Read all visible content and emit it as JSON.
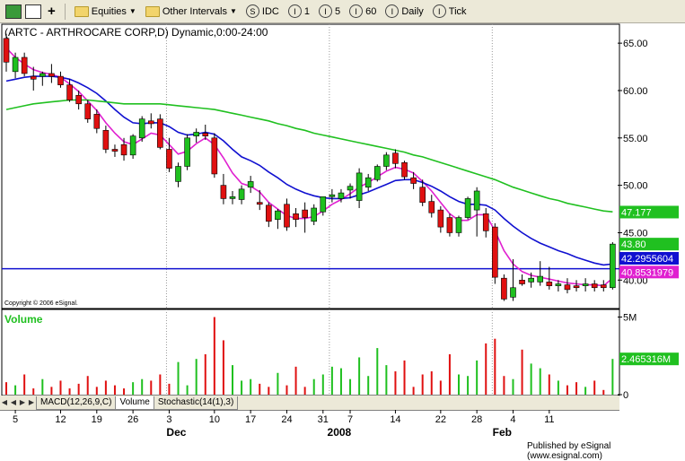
{
  "toolbar": {
    "equities_label": "Equities",
    "intervals_label": "Other Intervals",
    "symbol_label": "IDC",
    "interval_1": "1",
    "interval_5": "5",
    "interval_60": "60",
    "daily_label": "Daily",
    "tick_label": "Tick"
  },
  "chart_data": [
    {
      "type": "candlestick",
      "title": "(ARTC - ARTHROCARE CORP,D) Dynamic,0:00-24:00",
      "copyright": "Copyright © 2006 eSignal.",
      "ylim": [
        37,
        67
      ],
      "y_ticks": [
        "65.00",
        "60.00",
        "55.00",
        "50.00",
        "45.00",
        "40.00"
      ],
      "horizontal_line": 41.2,
      "candles": [
        {
          "o": 65.5,
          "h": 66.0,
          "l": 62.0,
          "c": 63.0
        },
        {
          "o": 62.0,
          "h": 64.0,
          "l": 61.3,
          "c": 63.5
        },
        {
          "o": 63.5,
          "h": 64.0,
          "l": 61.5,
          "c": 61.8
        },
        {
          "o": 61.5,
          "h": 62.5,
          "l": 60.0,
          "c": 61.2
        },
        {
          "o": 61.5,
          "h": 62.0,
          "l": 60.5,
          "c": 61.8
        },
        {
          "o": 61.8,
          "h": 62.8,
          "l": 60.8,
          "c": 61.5
        },
        {
          "o": 61.5,
          "h": 62.0,
          "l": 60.3,
          "c": 60.6
        },
        {
          "o": 60.6,
          "h": 61.2,
          "l": 58.8,
          "c": 59.0
        },
        {
          "o": 59.5,
          "h": 60.0,
          "l": 58.0,
          "c": 58.6
        },
        {
          "o": 58.6,
          "h": 59.0,
          "l": 56.6,
          "c": 57.0
        },
        {
          "o": 57.5,
          "h": 58.0,
          "l": 55.5,
          "c": 56.0
        },
        {
          "o": 55.8,
          "h": 56.3,
          "l": 53.4,
          "c": 53.8
        },
        {
          "o": 53.8,
          "h": 54.3,
          "l": 53.0,
          "c": 53.6
        },
        {
          "o": 54.3,
          "h": 55.0,
          "l": 52.6,
          "c": 53.2
        },
        {
          "o": 53.2,
          "h": 55.4,
          "l": 52.8,
          "c": 55.2
        },
        {
          "o": 55.0,
          "h": 57.3,
          "l": 54.6,
          "c": 57.0
        },
        {
          "o": 56.8,
          "h": 57.6,
          "l": 56.0,
          "c": 56.5
        },
        {
          "o": 57.0,
          "h": 57.5,
          "l": 53.8,
          "c": 54.0
        },
        {
          "o": 53.8,
          "h": 55.0,
          "l": 51.4,
          "c": 51.8
        },
        {
          "o": 50.4,
          "h": 52.4,
          "l": 49.8,
          "c": 52.0
        },
        {
          "o": 52.0,
          "h": 55.4,
          "l": 51.6,
          "c": 55.0
        },
        {
          "o": 55.2,
          "h": 56.0,
          "l": 54.5,
          "c": 55.6
        },
        {
          "o": 55.5,
          "h": 56.4,
          "l": 54.8,
          "c": 55.2
        },
        {
          "o": 55.0,
          "h": 55.5,
          "l": 50.8,
          "c": 51.2
        },
        {
          "o": 50.0,
          "h": 51.2,
          "l": 48.0,
          "c": 48.6
        },
        {
          "o": 48.6,
          "h": 49.4,
          "l": 48.0,
          "c": 48.8
        },
        {
          "o": 48.5,
          "h": 50.0,
          "l": 48.0,
          "c": 49.6
        },
        {
          "o": 49.8,
          "h": 51.0,
          "l": 49.2,
          "c": 50.4
        },
        {
          "o": 48.2,
          "h": 49.5,
          "l": 47.4,
          "c": 48.0
        },
        {
          "o": 47.9,
          "h": 48.2,
          "l": 45.6,
          "c": 46.2
        },
        {
          "o": 46.4,
          "h": 47.5,
          "l": 45.4,
          "c": 47.3
        },
        {
          "o": 48.0,
          "h": 48.6,
          "l": 45.2,
          "c": 45.6
        },
        {
          "o": 47.0,
          "h": 47.6,
          "l": 45.6,
          "c": 46.4
        },
        {
          "o": 47.4,
          "h": 48.2,
          "l": 45.0,
          "c": 46.6
        },
        {
          "o": 46.2,
          "h": 48.0,
          "l": 45.8,
          "c": 47.6
        },
        {
          "o": 47.2,
          "h": 48.8,
          "l": 46.8,
          "c": 48.8
        },
        {
          "o": 48.8,
          "h": 49.6,
          "l": 48.2,
          "c": 49.0
        },
        {
          "o": 48.6,
          "h": 49.6,
          "l": 48.2,
          "c": 49.2
        },
        {
          "o": 49.5,
          "h": 50.2,
          "l": 48.6,
          "c": 49.9
        },
        {
          "o": 48.4,
          "h": 51.8,
          "l": 47.6,
          "c": 51.3
        },
        {
          "o": 49.8,
          "h": 51.2,
          "l": 49.4,
          "c": 50.8
        },
        {
          "o": 50.6,
          "h": 52.2,
          "l": 50.4,
          "c": 52.0
        },
        {
          "o": 52.0,
          "h": 53.5,
          "l": 51.6,
          "c": 53.2
        },
        {
          "o": 53.4,
          "h": 53.8,
          "l": 51.8,
          "c": 52.3
        },
        {
          "o": 52.4,
          "h": 52.6,
          "l": 50.6,
          "c": 50.9
        },
        {
          "o": 50.8,
          "h": 51.4,
          "l": 49.6,
          "c": 50.2
        },
        {
          "o": 49.8,
          "h": 50.6,
          "l": 47.8,
          "c": 48.2
        },
        {
          "o": 48.3,
          "h": 49.0,
          "l": 46.6,
          "c": 47.1
        },
        {
          "o": 47.4,
          "h": 47.8,
          "l": 45.0,
          "c": 45.6
        },
        {
          "o": 46.6,
          "h": 47.0,
          "l": 44.6,
          "c": 45.0
        },
        {
          "o": 45.0,
          "h": 46.8,
          "l": 44.6,
          "c": 46.6
        },
        {
          "o": 46.6,
          "h": 48.8,
          "l": 46.4,
          "c": 48.6
        },
        {
          "o": 47.4,
          "h": 49.8,
          "l": 44.6,
          "c": 49.4
        },
        {
          "o": 47.0,
          "h": 47.6,
          "l": 44.5,
          "c": 45.2
        },
        {
          "o": 45.6,
          "h": 46.0,
          "l": 39.6,
          "c": 40.3
        },
        {
          "o": 40.2,
          "h": 40.6,
          "l": 37.8,
          "c": 38.0
        },
        {
          "o": 38.2,
          "h": 42.2,
          "l": 37.8,
          "c": 39.2
        },
        {
          "o": 40.0,
          "h": 40.6,
          "l": 39.4,
          "c": 39.6
        },
        {
          "o": 39.8,
          "h": 40.8,
          "l": 39.2,
          "c": 40.2
        },
        {
          "o": 39.8,
          "h": 42.0,
          "l": 39.4,
          "c": 40.4
        },
        {
          "o": 39.8,
          "h": 41.4,
          "l": 39.0,
          "c": 39.4
        },
        {
          "o": 39.4,
          "h": 40.0,
          "l": 38.8,
          "c": 39.6
        },
        {
          "o": 39.5,
          "h": 40.2,
          "l": 38.6,
          "c": 39.0
        },
        {
          "o": 39.4,
          "h": 40.0,
          "l": 38.8,
          "c": 39.2
        },
        {
          "o": 39.4,
          "h": 40.2,
          "l": 38.8,
          "c": 39.6
        },
        {
          "o": 39.6,
          "h": 40.0,
          "l": 38.8,
          "c": 39.2
        },
        {
          "o": 39.5,
          "h": 40.0,
          "l": 38.8,
          "c": 39.2
        },
        {
          "o": 39.2,
          "h": 44.0,
          "l": 39.0,
          "c": 43.8
        }
      ],
      "moving_averages": [
        {
          "name": "pink",
          "color": "#e020d0",
          "values": [
            64.5,
            63.5,
            62.8,
            62.2,
            61.9,
            61.7,
            61.4,
            60.7,
            59.9,
            58.9,
            57.9,
            56.6,
            55.5,
            54.6,
            54.3,
            54.9,
            55.5,
            55.3,
            54.3,
            53.3,
            53.6,
            54.4,
            55.0,
            54.3,
            52.9,
            51.3,
            50.2,
            49.9,
            49.3,
            48.2,
            47.5,
            46.8,
            46.5,
            46.5,
            46.7,
            47.3,
            48.0,
            48.5,
            49.1,
            49.8,
            50.3,
            50.9,
            51.5,
            51.9,
            51.7,
            51.3,
            50.4,
            49.4,
            48.2,
            47.0,
            46.3,
            46.3,
            46.9,
            46.9,
            45.2,
            43.1,
            41.7,
            40.9,
            40.5,
            40.3,
            40.1,
            39.9,
            39.7,
            39.6,
            39.5,
            39.5,
            39.4,
            40.2
          ]
        },
        {
          "name": "blue",
          "color": "#1010d0",
          "values": [
            61.0,
            61.2,
            61.4,
            61.5,
            61.5,
            61.5,
            61.4,
            61.2,
            60.8,
            60.3,
            59.7,
            58.9,
            58.0,
            57.2,
            56.6,
            56.5,
            56.6,
            56.6,
            56.2,
            55.6,
            55.3,
            55.4,
            55.6,
            55.4,
            54.7,
            53.8,
            53.0,
            52.6,
            52.1,
            51.4,
            50.8,
            50.1,
            49.6,
            49.2,
            48.9,
            48.7,
            48.6,
            48.6,
            48.7,
            49.0,
            49.3,
            49.7,
            50.1,
            50.5,
            50.6,
            50.6,
            50.3,
            49.9,
            49.4,
            48.8,
            48.3,
            48.0,
            48.0,
            47.9,
            47.4,
            46.5,
            45.7,
            45.0,
            44.4,
            43.9,
            43.5,
            43.1,
            42.8,
            42.4,
            42.1,
            41.8,
            41.6,
            41.7
          ]
        },
        {
          "name": "green",
          "color": "#20c020",
          "values": [
            58.0,
            58.2,
            58.4,
            58.6,
            58.7,
            58.8,
            58.9,
            59.0,
            59.0,
            59.0,
            58.9,
            58.8,
            58.7,
            58.6,
            58.6,
            58.6,
            58.6,
            58.6,
            58.5,
            58.4,
            58.3,
            58.2,
            58.1,
            58.0,
            57.8,
            57.6,
            57.4,
            57.2,
            57.0,
            56.8,
            56.5,
            56.3,
            56.0,
            55.8,
            55.5,
            55.3,
            55.1,
            54.9,
            54.7,
            54.5,
            54.3,
            54.1,
            53.9,
            53.7,
            53.5,
            53.2,
            53.0,
            52.7,
            52.4,
            52.1,
            51.8,
            51.5,
            51.2,
            50.9,
            50.6,
            50.2,
            49.8,
            49.5,
            49.2,
            48.9,
            48.6,
            48.4,
            48.1,
            47.9,
            47.7,
            47.5,
            47.3,
            47.2
          ]
        }
      ],
      "labels": [
        {
          "text": "47.177",
          "value": 47.177,
          "bg": "#20c020",
          "fg": "#ffffff"
        },
        {
          "text": "43.80",
          "value": 43.8,
          "bg": "#20c020",
          "fg": "#ffffff"
        },
        {
          "text": "42.2955604",
          "value": 42.3,
          "bg": "#1010d0",
          "fg": "#ffffff"
        },
        {
          "text": "40.8531979",
          "value": 40.85,
          "bg": "#e020d0",
          "fg": "#ffffff"
        }
      ]
    },
    {
      "type": "bar",
      "title": "Volume",
      "y_ticks": [
        "5M",
        "0"
      ],
      "current_label": "2.465316M",
      "ylim": [
        0,
        5.2
      ],
      "values": [
        0.8,
        0.6,
        1.3,
        0.4,
        1.0,
        0.5,
        0.9,
        0.4,
        0.7,
        1.2,
        0.5,
        0.9,
        0.6,
        0.4,
        0.8,
        1.0,
        0.9,
        1.3,
        0.7,
        2.1,
        0.6,
        2.3,
        2.6,
        5.0,
        3.5,
        1.9,
        0.9,
        1.0,
        0.7,
        0.5,
        1.4,
        0.6,
        1.8,
        0.5,
        1.0,
        1.3,
        1.8,
        1.7,
        1.0,
        2.4,
        1.2,
        3.0,
        1.9,
        1.5,
        2.2,
        0.5,
        1.3,
        1.5,
        0.9,
        2.6,
        1.3,
        1.2,
        2.2,
        3.3,
        3.6,
        1.2,
        1.0,
        2.9,
        2.0,
        1.7,
        1.3,
        0.9,
        0.6,
        0.8,
        0.5,
        0.9,
        0.3,
        2.3
      ],
      "colors": "match-candle"
    }
  ],
  "x_axis": {
    "day_labels": [
      {
        "text": "5",
        "index": 1
      },
      {
        "text": "12",
        "index": 6
      },
      {
        "text": "19",
        "index": 10
      },
      {
        "text": "26",
        "index": 14
      },
      {
        "text": "3",
        "index": 18
      },
      {
        "text": "10",
        "index": 23
      },
      {
        "text": "17",
        "index": 27
      },
      {
        "text": "24",
        "index": 31
      },
      {
        "text": "31",
        "index": 35
      },
      {
        "text": "7",
        "index": 38
      },
      {
        "text": "14",
        "index": 43
      },
      {
        "text": "22",
        "index": 48
      },
      {
        "text": "28",
        "index": 52
      },
      {
        "text": "4",
        "index": 56
      },
      {
        "text": "11",
        "index": 60
      }
    ],
    "month_labels": [
      {
        "text": "Dec",
        "index": 18
      },
      {
        "text": "2008",
        "index": 36
      },
      {
        "text": "Feb",
        "index": 54
      }
    ]
  },
  "tabs": [
    "MACD(12,26,9,C)",
    "Volume",
    "Stochastic(14(1),3)"
  ],
  "active_tab": 1,
  "footer": "Published by eSignal (www.esignal.com)"
}
